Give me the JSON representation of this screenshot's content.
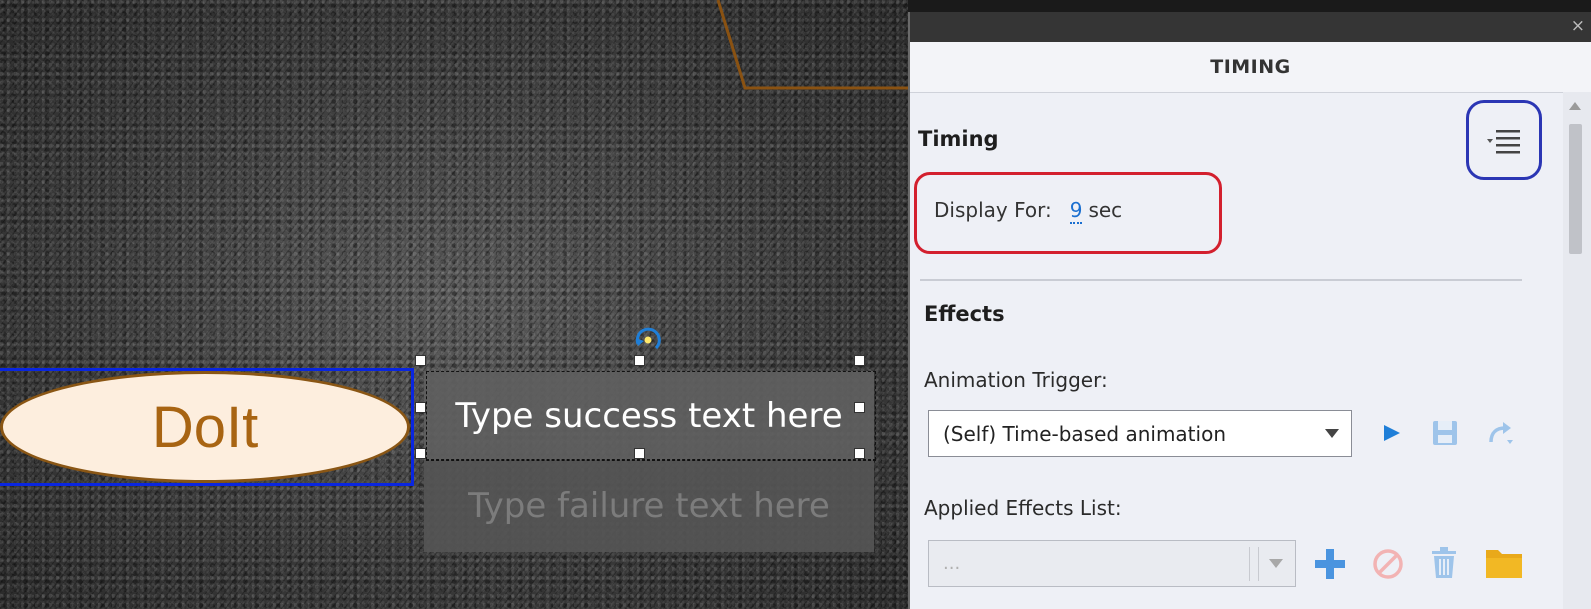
{
  "stage": {
    "button_label": "DoIt",
    "success_caption": "Type success text here",
    "failure_caption": "Type failure text here"
  },
  "panel": {
    "tab_title": "TIMING",
    "close_glyph": "×",
    "timing": {
      "section_title": "Timing",
      "display_for_label": "Display For:",
      "display_for_value": "9",
      "display_for_unit": "sec"
    },
    "effects": {
      "section_title": "Effects",
      "animation_trigger_label": "Animation Trigger:",
      "animation_trigger_value": "(Self) Time-based animation",
      "applied_effects_label": "Applied Effects List:",
      "applied_effects_value": "..."
    },
    "icons": {
      "panel_menu": "panel-menu-icon",
      "play": "play-icon",
      "save": "save-icon",
      "redo": "redo-icon",
      "add": "add-icon",
      "disable": "disable-icon",
      "delete": "trash-icon",
      "folder": "folder-icon"
    }
  },
  "colors": {
    "selection_blue": "#0a26e0",
    "annotation_red": "#d3202e",
    "annotation_blue": "#2b36b4",
    "link_blue": "#1a6fd0",
    "button_fill": "#fdeede",
    "button_text": "#a86412"
  }
}
